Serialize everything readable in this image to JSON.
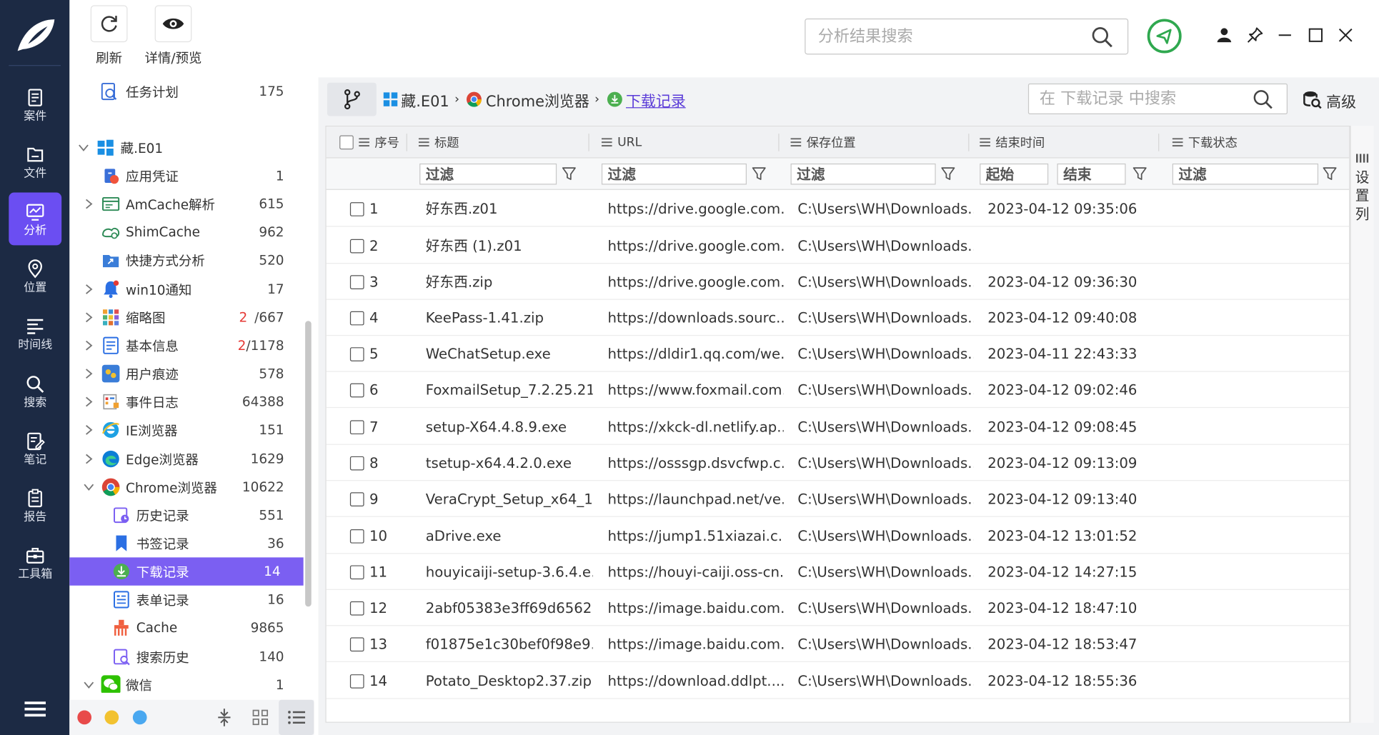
{
  "nav": {
    "items": [
      {
        "label": "案件",
        "icon": "case-icon"
      },
      {
        "label": "文件",
        "icon": "file-icon"
      },
      {
        "label": "分析",
        "icon": "analysis-icon",
        "active": true
      },
      {
        "label": "位置",
        "icon": "location-icon"
      },
      {
        "label": "时间线",
        "icon": "timeline-icon"
      },
      {
        "label": "搜索",
        "icon": "search-icon"
      },
      {
        "label": "笔记",
        "icon": "note-icon"
      },
      {
        "label": "报告",
        "icon": "report-icon"
      },
      {
        "label": "工具箱",
        "icon": "toolbox-icon"
      }
    ]
  },
  "toolbar": {
    "refresh_label": "刷新",
    "detail_label": "详情/预览"
  },
  "global_search": {
    "placeholder": "分析结果搜索"
  },
  "tree": {
    "nodes": [
      {
        "label": "任务计划",
        "count": "175"
      },
      {
        "label": "藏.E01"
      },
      {
        "label": "应用凭证",
        "count": "1"
      },
      {
        "label": "AmCache解析",
        "count": "615"
      },
      {
        "label": "ShimCache",
        "count": "962"
      },
      {
        "label": "快捷方式分析",
        "count": "520"
      },
      {
        "label": "win10通知",
        "count": "17"
      },
      {
        "label": "缩略图",
        "count_red": "2",
        "count": "/667"
      },
      {
        "label": "基本信息",
        "count_red": "2",
        "count": "/1178"
      },
      {
        "label": "用户痕迹",
        "count": "578"
      },
      {
        "label": "事件日志",
        "count": "64388"
      },
      {
        "label": "IE浏览器",
        "count": "151"
      },
      {
        "label": "Edge浏览器",
        "count": "1629"
      },
      {
        "label": "Chrome浏览器",
        "count": "10622"
      },
      {
        "label": "历史记录",
        "count": "551"
      },
      {
        "label": "书签记录",
        "count": "36"
      },
      {
        "label": "下载记录",
        "count": "14",
        "selected": true
      },
      {
        "label": "表单记录",
        "count": "16"
      },
      {
        "label": "Cache",
        "count": "9865"
      },
      {
        "label": "搜索历史",
        "count": "140"
      },
      {
        "label": "微信",
        "count": "1"
      }
    ]
  },
  "breadcrumb": {
    "items": [
      "藏.E01",
      "Chrome浏览器"
    ],
    "current": "下载记录"
  },
  "local_search": {
    "placeholder": "在 下载记录 中搜索"
  },
  "advanced_label": "高级",
  "table": {
    "columns": [
      "序号",
      "标题",
      "URL",
      "保存位置",
      "结束时间",
      "下载状态"
    ],
    "filter_placeholder": "过滤",
    "filter_start": "起始",
    "filter_end": "结束",
    "rows": [
      {
        "no": "1",
        "title": "好东西.z01",
        "url": "https://drive.google.com...",
        "path": "C:\\Users\\WH\\Downloads...",
        "end": "2023-04-12 09:35:06"
      },
      {
        "no": "2",
        "title": "好东西 (1).z01",
        "url": "https://drive.google.com...",
        "path": "C:\\Users\\WH\\Downloads...",
        "end": ""
      },
      {
        "no": "3",
        "title": "好东西.zip",
        "url": "https://drive.google.com...",
        "path": "C:\\Users\\WH\\Downloads...",
        "end": "2023-04-12 09:36:30"
      },
      {
        "no": "4",
        "title": "KeePass-1.41.zip",
        "url": "https://downloads.sourc...",
        "path": "C:\\Users\\WH\\Downloads...",
        "end": "2023-04-12 09:40:08"
      },
      {
        "no": "5",
        "title": "WeChatSetup.exe",
        "url": "https://dldir1.qq.com/we...",
        "path": "C:\\Users\\WH\\Downloads...",
        "end": "2023-04-11 22:43:33"
      },
      {
        "no": "6",
        "title": "FoxmailSetup_7.2.25.21...",
        "url": "https://www.foxmail.com...",
        "path": "C:\\Users\\WH\\Downloads...",
        "end": "2023-04-12 09:02:46"
      },
      {
        "no": "7",
        "title": "setup-X64.4.8.9.exe",
        "url": "https://xkck-dl.netlify.ap...",
        "path": "C:\\Users\\WH\\Downloads...",
        "end": "2023-04-12 09:08:45"
      },
      {
        "no": "8",
        "title": "tsetup-x64.4.2.0.exe",
        "url": "https://osssgp.dsvcfwp.c...",
        "path": "C:\\Users\\WH\\Downloads...",
        "end": "2023-04-12 09:13:09"
      },
      {
        "no": "9",
        "title": "VeraCrypt_Setup_x64_1....",
        "url": "https://launchpad.net/ve...",
        "path": "C:\\Users\\WH\\Downloads...",
        "end": "2023-04-12 09:13:40"
      },
      {
        "no": "10",
        "title": "aDrive.exe",
        "url": "https://jump1.51xiazai.c...",
        "path": "C:\\Users\\WH\\Downloads...",
        "end": "2023-04-12 13:01:52"
      },
      {
        "no": "11",
        "title": "houyicaiji-setup-3.6.4.e...",
        "url": "https://houyi-caiji.oss-cn...",
        "path": "C:\\Users\\WH\\Downloads...",
        "end": "2023-04-12 14:27:15"
      },
      {
        "no": "12",
        "title": "2abf05383e3ff69d6562...",
        "url": "https://image.baidu.com...",
        "path": "C:\\Users\\WH\\Downloads...",
        "end": "2023-04-12 18:47:10"
      },
      {
        "no": "13",
        "title": "f01875e1c30bef0f98e9...",
        "url": "https://image.baidu.com...",
        "path": "C:\\Users\\WH\\Downloads...",
        "end": "2023-04-12 18:53:47"
      },
      {
        "no": "14",
        "title": "Potato_Desktop2.37.zip",
        "url": "https://download.ddlpt....",
        "path": "C:\\Users\\WH\\Downloads...",
        "end": "2023-04-12 18:55:36"
      }
    ]
  },
  "column_settings_label": "设置列",
  "colors": {
    "nav_bg": "#1c2a44",
    "accent": "#6b4ef2",
    "status_green": "#2fa84f",
    "dot_red": "#e84a4a",
    "dot_yellow": "#f2c230",
    "dot_blue": "#4aa8f0"
  }
}
